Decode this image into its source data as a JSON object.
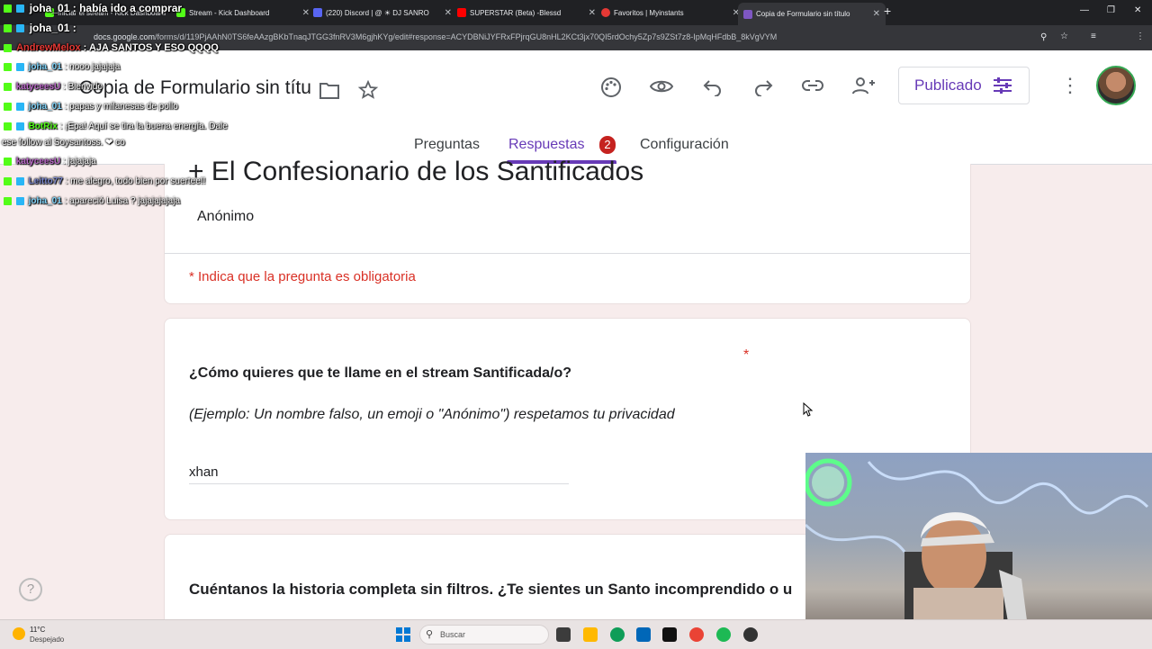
{
  "browser": {
    "tabs": [
      {
        "title": "Iniciar el stream - Kick Dashboard",
        "favicon_color": "#53fc18"
      },
      {
        "title": "Stream - Kick Dashboard",
        "favicon_color": "#53fc18"
      },
      {
        "title": "(220) Discord | @ ☀ DJ SANRO",
        "favicon_color": "#5865f2"
      },
      {
        "title": "SUPERSTAR (Beta) -Blessd",
        "favicon_color": "#ff0000"
      },
      {
        "title": "Favoritos | Myinstants",
        "favicon_color": "#e53935"
      },
      {
        "title": "Copia de Formulario sin título",
        "favicon_color": "#7e57c2"
      }
    ],
    "url": "docs.google.com/forms/d/119PjAAhN0TS6feAAzgBKbTnaqJTGG3fnRV3M6gjhKYg/edit#response=ACYDBNiJYFRxFPjrqGU8nHL2KCt3jx70QI5rdOchy5Zp7s9ZSt7z8-IpMqHFdbB_8kVgVYM",
    "url_domain": "docs.google.com"
  },
  "forms": {
    "doc_title": "Copia de Formulario sin títu",
    "publish_label": "Publicado",
    "tabs": [
      "Preguntas",
      "Respuestas",
      "Configuración"
    ],
    "responses_count": "2",
    "form_title": "+  El Confesionario de los Santificados",
    "form_author": "Anónimo",
    "required_note": "* Indica que la pregunta es obligatoria",
    "q1": {
      "title": "¿Cómo quieres que te llame en el stream Santificada/o?",
      "description": "(Ejemplo: Un nombre falso, un emoji o \"Anónimo\") respetamos tu privacidad",
      "answer": "xhan",
      "required_mark": "*"
    },
    "q2": {
      "title": "Cuéntanos la historia completa sin filtros. ¿Te sientes un Santo incomprendido o u"
    },
    "accent_color": "#673ab7",
    "required_color": "#d93025"
  },
  "chat": {
    "top_message": {
      "user": "joha_01",
      "text": ": había ido a comprar"
    },
    "messages": [
      {
        "user": "joha_01",
        "text": ":",
        "user_color": "#5bc0de"
      },
      {
        "user": "AndrewMelox",
        "text": ": AJA SANTOS Y ESO QQQQ",
        "user_color": "#c62828"
      },
      {
        "user": "joha_01",
        "text": ": nooo jajajaja",
        "user_color": "#5bc0de"
      },
      {
        "user": "katyceesU",
        "text": ": Bienvido",
        "user_color": "#7b1fa2"
      },
      {
        "user": "joha_01",
        "text": ": papas y milanesas de pollo",
        "user_color": "#5bc0de"
      },
      {
        "user": "BotRix",
        "text": ": ¡Epa! Aquí se tira la buena energía. Dale",
        "user_color": "#53fc18"
      },
      {
        "user": "",
        "text": "ese follow al Soysantoss. ❤ co",
        "user_color": "#ffffff"
      },
      {
        "user": "katyceesU",
        "text": ": jajajaja",
        "user_color": "#7b1fa2"
      },
      {
        "user": "Leitto77",
        "text": ": me alegro, todo bien por suertee!!",
        "user_color": "#3f51b5"
      },
      {
        "user": "joha_01",
        "text": ": apareció Luisa ? jajajajajaja",
        "user_color": "#5bc0de"
      }
    ]
  },
  "taskbar": {
    "weather_temp": "11°C",
    "weather_desc": "Despejado",
    "search_placeholder": "Buscar"
  }
}
